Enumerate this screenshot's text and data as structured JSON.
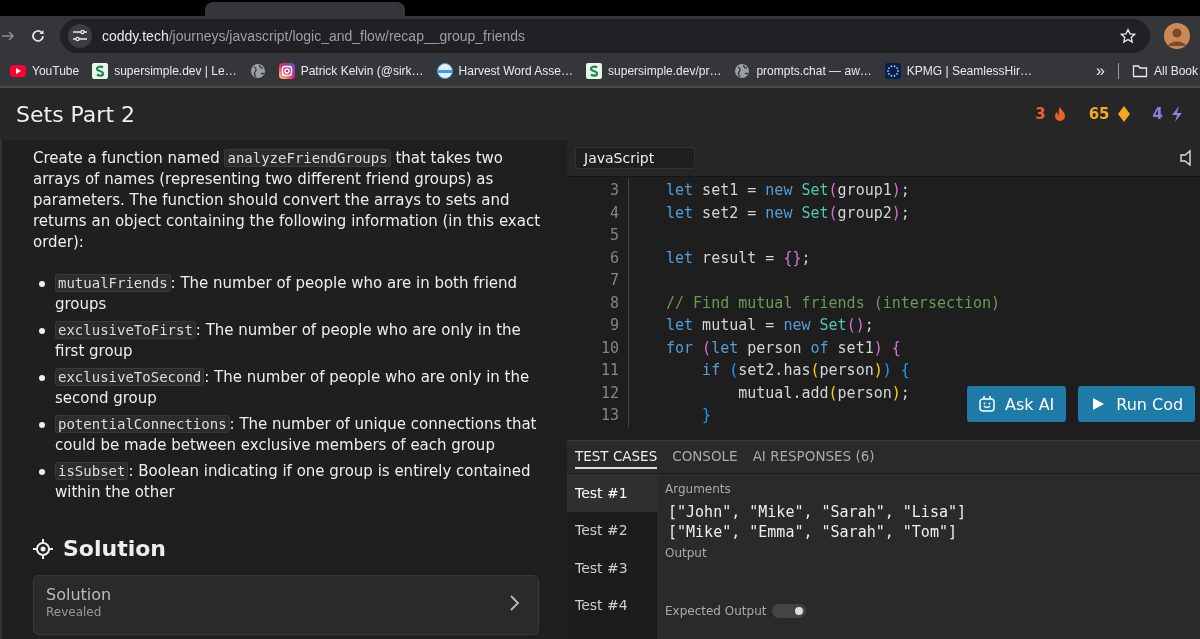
{
  "browser": {
    "address": {
      "host": "coddy.tech",
      "path": "/journeys/javascript/logic_and_flow/recap__group_friends"
    },
    "bookmarks": [
      {
        "kind": "youtube",
        "label": "YouTube"
      },
      {
        "kind": "s-logo",
        "label": "supersimple.dev | Le…"
      },
      {
        "kind": "globe"
      },
      {
        "kind": "instagram",
        "label": "Patrick Kelvin (@sirk…"
      },
      {
        "kind": "harvest",
        "label": "Harvest Word Asse…"
      },
      {
        "kind": "s-logo",
        "label": "supersimple.dev/pr…"
      },
      {
        "kind": "globe",
        "label": "prompts.chat — aw…"
      },
      {
        "kind": "kpmg",
        "label": "KPMG | SeamlessHir…"
      }
    ],
    "more": "»",
    "all_bookmarks": "All Book"
  },
  "header": {
    "title": "Sets Part 2",
    "stats": [
      {
        "kind": "streak",
        "value": "3"
      },
      {
        "kind": "gems",
        "value": "65"
      },
      {
        "kind": "energy",
        "value": "4"
      }
    ]
  },
  "task": {
    "intro": {
      "before": "Create a function named ",
      "code": "analyzeFriendGroups",
      "after": " that takes two arrays of names (representing two different friend groups) as parameters. The function should convert the arrays to sets and returns an object containing the following information (in this exact order):"
    },
    "items": [
      {
        "code": "mutualFriends",
        "text": ": The number of people who are in both friend groups"
      },
      {
        "code": "exclusiveToFirst",
        "text": ": The number of people who are only in the first group"
      },
      {
        "code": "exclusiveToSecond",
        "text": ": The number of people who are only in the second group"
      },
      {
        "code": "potentialConnections",
        "text": ": The number of unique connections that could be made between exclusive members of each group"
      },
      {
        "code": "isSubset",
        "text": ": Boolean indicating if one group is entirely contained within the other"
      }
    ],
    "solution_heading": "Solution",
    "solution_card": {
      "title": "Solution",
      "status": "Revealed"
    }
  },
  "editor": {
    "language": "JavaScript",
    "lines": [
      {
        "number": "3",
        "tokens": [
          {
            "kind": "kw",
            "text": "let"
          },
          {
            "kind": "plain",
            "text": " set1 = "
          },
          {
            "kind": "kw",
            "text": "new"
          },
          {
            "kind": "type",
            "text": " Set"
          },
          {
            "kind": "p1",
            "text": "("
          },
          {
            "kind": "plain",
            "text": "group1"
          },
          {
            "kind": "p1",
            "text": ")"
          },
          {
            "kind": "plain",
            "text": ";"
          }
        ]
      },
      {
        "number": "4",
        "tokens": [
          {
            "kind": "kw",
            "text": "let"
          },
          {
            "kind": "plain",
            "text": " set2 = "
          },
          {
            "kind": "kw",
            "text": "new"
          },
          {
            "kind": "type",
            "text": " Set"
          },
          {
            "kind": "p1",
            "text": "("
          },
          {
            "kind": "plain",
            "text": "group2"
          },
          {
            "kind": "p1",
            "text": ")"
          },
          {
            "kind": "plain",
            "text": ";"
          }
        ]
      },
      {
        "number": "5"
      },
      {
        "number": "6",
        "tokens": [
          {
            "kind": "kw",
            "text": "let"
          },
          {
            "kind": "plain",
            "text": " result = "
          },
          {
            "kind": "p1",
            "text": "{}"
          },
          {
            "kind": "plain",
            "text": ";"
          }
        ]
      },
      {
        "number": "7"
      },
      {
        "number": "8",
        "tokens": [
          {
            "kind": "comment",
            "text": "// Find mutual friends (intersection)"
          }
        ]
      },
      {
        "number": "9",
        "tokens": [
          {
            "kind": "kw",
            "text": "let"
          },
          {
            "kind": "plain",
            "text": " mutual = "
          },
          {
            "kind": "kw",
            "text": "new"
          },
          {
            "kind": "type",
            "text": " Set"
          },
          {
            "kind": "p1",
            "text": "()"
          },
          {
            "kind": "plain",
            "text": ";"
          }
        ]
      },
      {
        "number": "10",
        "tokens": [
          {
            "kind": "kw",
            "text": "for"
          },
          {
            "kind": "p1",
            "text": " ("
          },
          {
            "kind": "kw",
            "text": "let"
          },
          {
            "kind": "plain",
            "text": " person "
          },
          {
            "kind": "kw",
            "text": "of"
          },
          {
            "kind": "plain",
            "text": " set1"
          },
          {
            "kind": "p1",
            "text": ") {"
          }
        ]
      },
      {
        "number": "11",
        "tokens": [
          {
            "kind": "kw",
            "text": "    if"
          },
          {
            "kind": "p2",
            "text": " ("
          },
          {
            "kind": "plain",
            "text": "set2.has"
          },
          {
            "kind": "p3",
            "text": "("
          },
          {
            "kind": "plain",
            "text": "person"
          },
          {
            "kind": "p3",
            "text": ")"
          },
          {
            "kind": "p2",
            "text": ") {"
          }
        ]
      },
      {
        "number": "12",
        "tokens": [
          {
            "kind": "plain",
            "text": "        mutual.add"
          },
          {
            "kind": "p3",
            "text": "("
          },
          {
            "kind": "plain",
            "text": "person"
          },
          {
            "kind": "p3",
            "text": ")"
          },
          {
            "kind": "plain",
            "text": ";"
          }
        ]
      },
      {
        "number": "13",
        "tokens": [
          {
            "kind": "p2",
            "text": "    }"
          }
        ]
      }
    ],
    "buttons": [
      {
        "kind": "ai",
        "label": "Ask AI"
      },
      {
        "kind": "run",
        "label": "Run Cod"
      }
    ]
  },
  "tests": {
    "tabs": [
      {
        "label": "TEST CASES",
        "selected": true
      },
      {
        "label": "CONSOLE",
        "selected": false
      },
      {
        "label": "AI RESPONSES (6)",
        "selected": false
      }
    ],
    "cases": [
      {
        "label": "Test #1",
        "selected": true
      },
      {
        "label": "Test #2",
        "selected": false
      },
      {
        "label": "Test #3",
        "selected": false
      },
      {
        "label": "Test #4",
        "selected": false
      }
    ],
    "arguments_label": "Arguments",
    "arguments": [
      "[\"John\", \"Mike\", \"Sarah\", \"Lisa\"]",
      "[\"Mike\", \"Emma\", \"Sarah\", \"Tom\"]"
    ],
    "output_label": "Output",
    "expected_label": "Expected Output",
    "expected_toggle": {
      "on": true
    }
  }
}
